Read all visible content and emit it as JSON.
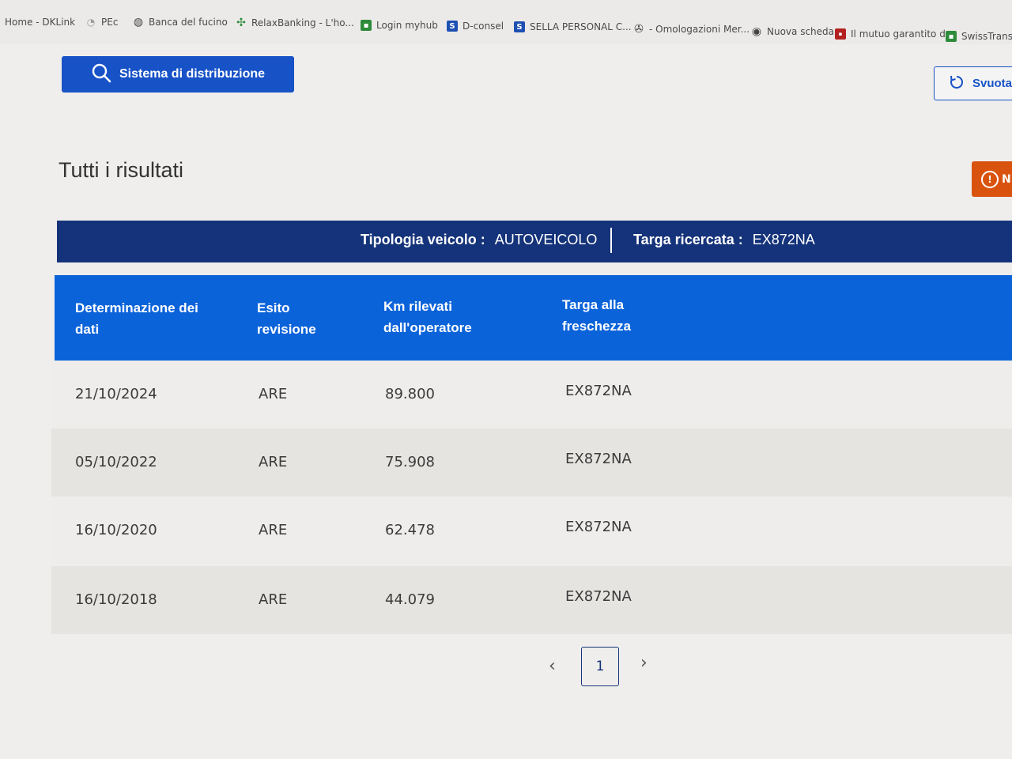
{
  "bookmarks": [
    {
      "label": "Home - DKLink",
      "icon": "none"
    },
    {
      "label": "PEc",
      "icon": "lock-icon"
    },
    {
      "label": "Banca del fucino",
      "icon": "globe-icon"
    },
    {
      "label": "RelaxBanking - L'ho...",
      "icon": "relax-icon"
    },
    {
      "label": "Login myhub",
      "icon": "green-icon"
    },
    {
      "label": "D-consel",
      "icon": "s-icon"
    },
    {
      "label": "SELLA PERSONAL C...",
      "icon": "s-icon"
    },
    {
      "label": "- Omologazioni Mer...",
      "icon": "mercedes-icon"
    },
    {
      "label": "Nuova scheda",
      "icon": "chrome-icon"
    },
    {
      "label": "Il mutuo garantito d...",
      "icon": "red-icon"
    },
    {
      "label": "SwissTransfer",
      "icon": "green-icon"
    }
  ],
  "toolbar": {
    "search_label": "Sistema di distribuzione",
    "clear_label": "Svuota",
    "alert_label": "N"
  },
  "page_title": "Tutti i risultati",
  "info": {
    "vehicle_type_label": "Tipologia veicolo :",
    "vehicle_type_value": "AUTOVEICOLO",
    "plate_label": "Targa ricercata :",
    "plate_value": "EX872NA"
  },
  "table": {
    "headers": [
      "Determinazione dei dati",
      "Esito revisione",
      "Km rilevati dall'operatore",
      "Targa alla freschezza"
    ],
    "rows": [
      [
        "21/10/2024",
        "ARE",
        "89.800",
        "EX872NA"
      ],
      [
        "05/10/2022",
        "ARE",
        "75.908",
        "EX872NA"
      ],
      [
        "16/10/2020",
        "ARE",
        "62.478",
        "EX872NA"
      ],
      [
        "16/10/2018",
        "ARE",
        "44.079",
        "EX872NA"
      ]
    ]
  },
  "pagination": {
    "current_page": "1",
    "prev": "‹",
    "next": "›"
  },
  "colors": {
    "primary": "#1752c7",
    "header_bar": "#15337a",
    "table_header": "#0b63d9",
    "alert": "#d9530f"
  }
}
